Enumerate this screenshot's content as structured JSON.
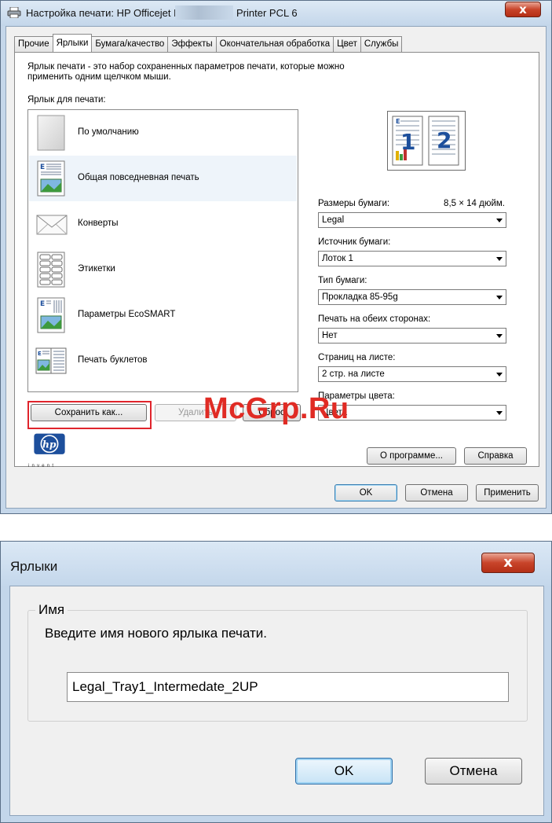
{
  "print_dialog": {
    "title": "Настройка печати: HP Officejet Pro",
    "title_suffix": "Printer PCL 6",
    "close_label": "x",
    "tabs": [
      {
        "label": "Прочие",
        "active": false
      },
      {
        "label": "Ярлыки",
        "active": true
      },
      {
        "label": "Бумага/качество",
        "active": false
      },
      {
        "label": "Эффекты",
        "active": false
      },
      {
        "label": "Окончательная обработка",
        "active": false
      },
      {
        "label": "Цвет",
        "active": false
      },
      {
        "label": "Службы",
        "active": false
      }
    ],
    "description": "Ярлык печати - это набор сохраненных параметров печати, которые можно применить одним щелчком мыши.",
    "list_label": "Ярлык для печати:",
    "shortcuts": [
      {
        "label": "По умолчанию",
        "icon": "blank-page-icon"
      },
      {
        "label": "Общая повседневная печать",
        "icon": "document-picture-icon",
        "selected": true
      },
      {
        "label": "Конверты",
        "icon": "envelope-icon"
      },
      {
        "label": "Этикетки",
        "icon": "labels-icon"
      },
      {
        "label": "Параметры EcoSMART",
        "icon": "ecosmart-document-icon"
      },
      {
        "label": "Печать буклетов",
        "icon": "booklet-icon"
      }
    ],
    "buttons": {
      "save_as": "Сохранить как...",
      "delete": "Удалить",
      "reset": "Сброс",
      "about": "О программе...",
      "help": "Справка",
      "ok": "OK",
      "cancel": "Отмена",
      "apply": "Применить"
    },
    "preview": {
      "page1": "1",
      "page2": "2"
    },
    "fields": {
      "paper_size_label": "Размеры бумаги:",
      "paper_size_value_text": "8,5 × 14 дюйм.",
      "paper_size": "Legal",
      "paper_source_label": "Источник бумаги:",
      "paper_source": "Лоток 1",
      "paper_type_label": "Тип бумаги:",
      "paper_type": "Прокладка 85-95g",
      "duplex_label": "Печать на обеих сторонах:",
      "duplex": "Нет",
      "pages_per_sheet_label": "Страниц на листе:",
      "pages_per_sheet": "2 стр. на листе",
      "color_label": "Параметры цвета:",
      "color": "Цвета"
    },
    "logo_text": "invent",
    "watermark": "McGrp.Ru",
    "colors": {
      "highlight": "#e0242c",
      "hp_blue": "#1d4f9c",
      "close_red": "#c8442a"
    }
  },
  "shortcut_dialog": {
    "title": "Ярлыки",
    "close_label": "x",
    "group_label": "Имя",
    "prompt": "Введите имя нового ярлыка печати.",
    "name_value": "Legal_Tray1_Intermedate_2UP",
    "ok": "OK",
    "cancel": "Отмена"
  }
}
